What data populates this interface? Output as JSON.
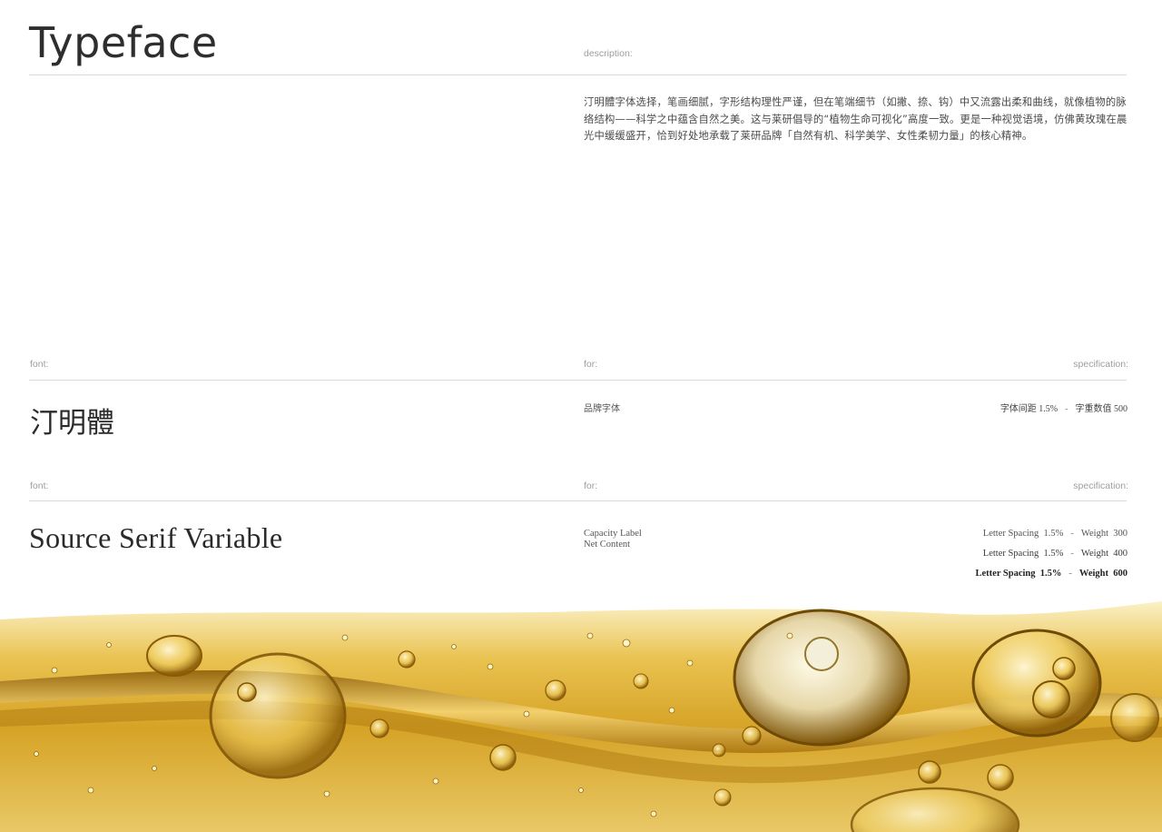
{
  "header": {
    "title": "Typeface",
    "description_label": "description:"
  },
  "description": {
    "text": "汀明體字体选择，笔画细腻，字形结构理性严谨，但在笔端细节（如撇、捺、钩）中又流露出柔和曲线，就像植物的脉络结构——科学之中蕴含自然之美。这与莱研倡导的“植物生命可视化”高度一致。更是一种视觉语境，仿佛黄玫瑰在晨光中缓缓盛开，恰到好处地承载了莱研品牌「自然有机、科学美学、女性柔韧力量」的核心精神。"
  },
  "fonts": [
    {
      "font_label": "font:",
      "for_label": "for:",
      "spec_label": "specification:",
      "name": "汀明體",
      "usage": [
        "品牌字体"
      ],
      "specs": [
        {
          "spacing": "字体间距 1.5%",
          "weight": "字重数值 500"
        }
      ]
    },
    {
      "font_label": "font:",
      "for_label": "for:",
      "spec_label": "specification:",
      "name": "Source Serif Variable",
      "usage": [
        "Capacity Label",
        "Net Content"
      ],
      "specs": [
        {
          "spacing": "Letter Spacing  1.5%",
          "weight": "Weight  300"
        },
        {
          "spacing": "Letter Spacing  1.5%",
          "weight": "Weight  400"
        },
        {
          "spacing": "Letter Spacing  1.5%",
          "weight": "Weight  600"
        }
      ]
    }
  ],
  "spec_separator": "-",
  "colors": {
    "oil_light": "#f6e7a8",
    "oil_mid": "#d9a92a",
    "oil_deep": "#a46f0c",
    "rule": "#d9d9d9"
  },
  "decor": {
    "background_image": "golden-oil-bubbles"
  }
}
